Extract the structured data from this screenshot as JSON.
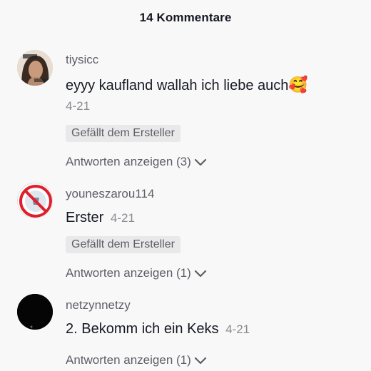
{
  "header": {
    "title": "14 Kommentare"
  },
  "comments": [
    {
      "username": "tiysicc",
      "text": "eyyy kaufland wallah ich liebe auch",
      "emoji": "🥰",
      "date": "4-21",
      "badge": "Gefällt dem Ersteller",
      "replies": "Antworten anzeigen (3)"
    },
    {
      "username": "youneszarou114",
      "text": "Erster",
      "date": "4-21",
      "badge": "Gefällt dem Ersteller",
      "replies": "Antworten anzeigen (1)"
    },
    {
      "username": "netzynnetzy",
      "text": "2. Bekomm ich ein Keks",
      "date": "4-21",
      "replies": "Antworten anzeigen (1)"
    }
  ],
  "colors": {
    "background": "#f8f8f8",
    "primary_text": "#161823",
    "secondary_text": "#5e5f66",
    "badge_bg": "#e9e9ea"
  }
}
